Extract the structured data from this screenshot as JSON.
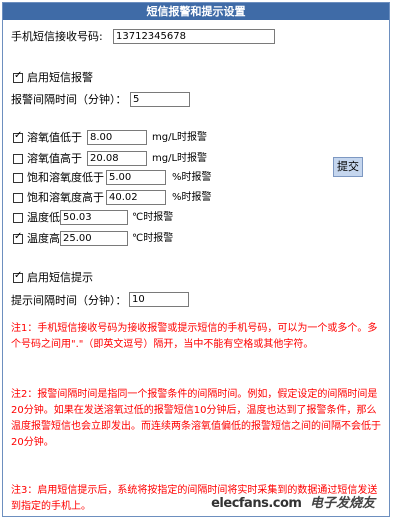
{
  "title": "短信报警和提示设置",
  "phone": {
    "label": "手机短信接收号码:",
    "value": "13712345678"
  },
  "sms_alarm": {
    "enabled": true,
    "label": "启用短信报警"
  },
  "alarm_interval": {
    "label": "报警间隔时间（分钟）：",
    "value": "5"
  },
  "conditions": [
    {
      "checked": true,
      "label": "溶氧值低于",
      "value": "8.00",
      "suffix": "mg/L时报警"
    },
    {
      "checked": false,
      "label": "溶氧值高于",
      "value": "20.08",
      "suffix": "mg/L时报警"
    },
    {
      "checked": false,
      "label": "饱和溶氧度低于",
      "value": "5.00",
      "suffix": "%时报警"
    },
    {
      "checked": false,
      "label": "饱和溶氧度高于",
      "value": "40.02",
      "suffix": "%时报警"
    },
    {
      "checked": false,
      "label": "温度低于",
      "value": "50.03",
      "suffix": "℃时报警"
    },
    {
      "checked": true,
      "label": "温度高于",
      "value": "25.00",
      "suffix": "℃时报警"
    }
  ],
  "submit_label": "提交",
  "sms_prompt": {
    "enabled": true,
    "label": "启用短信提示"
  },
  "prompt_interval": {
    "label": "提示间隔时间（分钟）：",
    "value": "10"
  },
  "notes": [
    "注1：手机短信接收号码为接收报警或提示短信的手机号码，可以为一个或多个。多个号码之间用\".\"（即英文逗号）隔开，当中不能有空格或其他字符。",
    "注2：报警间隔时间是指同一个报警条件的间隔时间。例如，假定设定的间隔时间是20分钟。如果在发送溶氧过低的报警短信10分钟后，温度也达到了报警条件，那么温度报警短信也会立即发出。而连续两条溶氧值偏低的报警短信之间的间隔不会低于20分钟。",
    "注3：启用短信提示后，系统将按指定的间隔时间将实时采集到的数据通过短信发送到指定的手机上。"
  ],
  "watermark": {
    "logo": "elecfans.com",
    "cn": "电子发烧友"
  },
  "colors": {
    "title_bg": "#3f6ba7",
    "note_text": "#ff0000",
    "submit_bg": "#c5d6ee"
  }
}
